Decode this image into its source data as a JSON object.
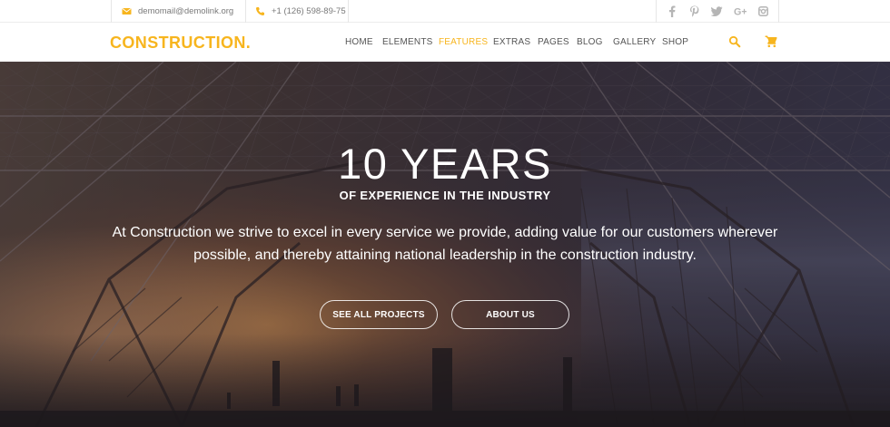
{
  "topbar": {
    "email": "demomail@demolink.org",
    "phone": "+1 (126) 598-89-75",
    "socials": [
      {
        "icon": "facebook-icon",
        "glyph": "f"
      },
      {
        "icon": "pinterest-icon",
        "glyph": "P"
      },
      {
        "icon": "twitter-icon",
        "glyph": "t"
      },
      {
        "icon": "google-plus-icon",
        "glyph": "G+"
      },
      {
        "icon": "instagram-icon",
        "glyph": ""
      }
    ]
  },
  "navbar": {
    "logo": "CONSTRUCTION.",
    "items": [
      "HOME",
      "ELEMENTS",
      "FEATURES",
      "EXTRAS",
      "PAGES",
      "BLOG",
      "GALLERY",
      "SHOP"
    ],
    "active_item": "FEATURES"
  },
  "hero": {
    "title": "10 YEARS",
    "subtitle": "OF EXPERIENCE IN THE INDUSTRY",
    "text": "At Construction we strive to excel in every service we provide, adding value for our customers wherever possible, and thereby attaining national leadership in the construction industry.",
    "buttons": {
      "projects": "SEE ALL PROJECTS",
      "about": "ABOUT US"
    }
  },
  "colors": {
    "accent": "#f7b51e",
    "nav_text": "#555555",
    "topbar_text": "#7a7a7a",
    "social_icons": "#b5b5b5"
  }
}
